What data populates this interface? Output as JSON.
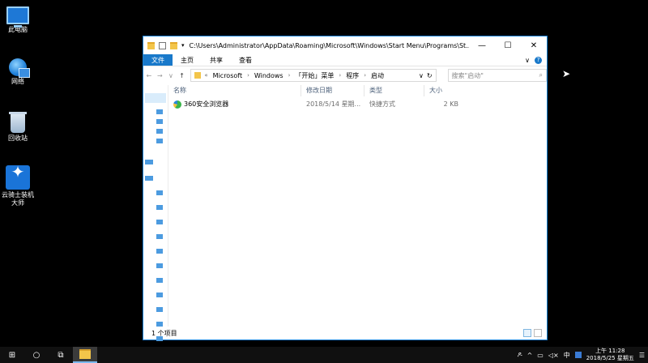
{
  "desktop": {
    "icons": [
      {
        "label": "此电脑"
      },
      {
        "label": "网络"
      },
      {
        "label": "回收站"
      },
      {
        "label_line1": "云骑士装机",
        "label_line2": "大师"
      }
    ]
  },
  "window": {
    "title_path": "C:\\Users\\Administrator\\AppData\\Roaming\\Microsoft\\Windows\\Start Menu\\Programs\\St...",
    "minimize": "—",
    "maximize": "☐",
    "close": "✕",
    "ribbon_tabs": [
      "文件",
      "主页",
      "共享",
      "查看"
    ],
    "ribbon_expand": "∨",
    "help": "?",
    "address": {
      "prefix": "«",
      "crumbs": [
        "Microsoft",
        "Windows",
        "「开始」菜单",
        "程序",
        "启动"
      ],
      "separator": "›",
      "dropdown": "∨",
      "refresh": "↻"
    },
    "search_placeholder": "搜索\"启动\"",
    "search_icon": "⌕",
    "columns": [
      "名称",
      "修改日期",
      "类型",
      "大小"
    ],
    "files": [
      {
        "name": "360安全浏览器",
        "date": "2018/5/14 星期...",
        "type": "快捷方式",
        "size": "2 KB"
      }
    ],
    "status": "1 个项目"
  },
  "taskbar": {
    "start": "⊞",
    "search": "○",
    "taskview": "⧉",
    "ime": "中",
    "time": "上午 11:28",
    "date": "2018/5/25 星期五",
    "notifications": "☰"
  }
}
